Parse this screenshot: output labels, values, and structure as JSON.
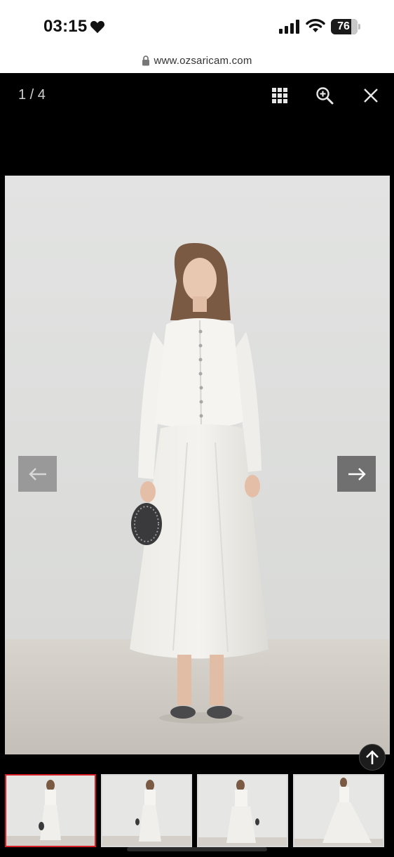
{
  "status_bar": {
    "time": "03:15",
    "battery": "76",
    "battery_level": 0.76,
    "icons": [
      "heart-icon",
      "cellular-signal-icon",
      "wifi-icon",
      "battery-icon"
    ]
  },
  "browser": {
    "url": "www.ozsaricam.com",
    "icon": "lock-icon"
  },
  "gallery": {
    "counter": "1 / 4",
    "controls": {
      "grid_icon": "grid-icon",
      "zoom_icon": "zoom-in-icon",
      "close_icon": "close-icon",
      "prev_icon": "arrow-left-icon",
      "next_icon": "arrow-right-icon",
      "scroll_top_icon": "arrow-up-icon"
    },
    "thumbnail_count": 4,
    "active_thumbnail": 1
  },
  "colors": {
    "viewer_background": "#000000",
    "active_thumbnail_border": "#d61f26",
    "photo_wall": "#e4e4e2",
    "photo_floor": "#cfcac4"
  }
}
